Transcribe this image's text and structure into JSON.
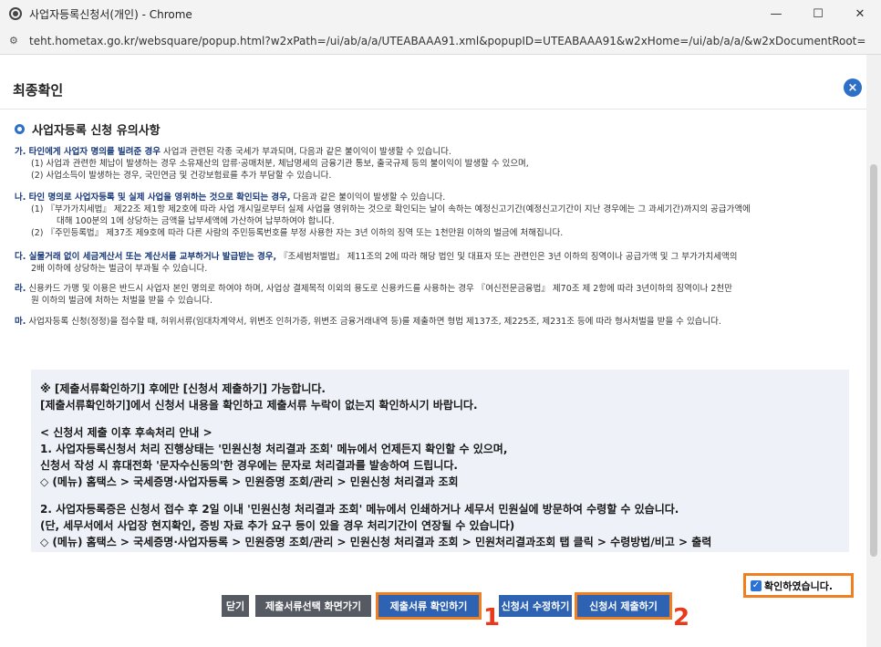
{
  "window": {
    "title": "사업자등록신청서(개인) - Chrome",
    "url": "teht.hometax.go.kr/websquare/popup.html?w2xPath=/ui/ab/a/a/UTEABAAA91.xml&popupID=UTEABAAA91&w2xHome=/ui/ab/a/a/&w2xDocumentRoot=",
    "controls": {
      "minimize": "—",
      "maximize": "☐",
      "close": "✕"
    }
  },
  "dialog": {
    "title": "최종확인",
    "close_label": "×",
    "section_title": "사업자등록 신청 유의사항"
  },
  "notices": [
    {
      "lead": "가. 타인에게 사업자 명의를 빌려준 경우",
      "text": " 사업과 관련된 각종 국세가 부과되며, 다음과 같은 불이익이 발생할 수 있습니다.",
      "subs": [
        "(1) 사업과 관련한 체납이 발생하는 경우 소유재산의 압류·공매처분, 체납명세의 금융기관 통보, 출국규제 등의 불이익이 발생할 수 있으며,",
        "(2) 사업소득이 발생하는 경우, 국민연금 및 건강보험료를 추가 부담할 수 있습니다."
      ]
    },
    {
      "lead": "나. 타인 명의로 사업자등록 및 실제 사업을 영위하는 것으로 확인되는 경우,",
      "text": " 다음과 같은 불이익이 발생할 수 있습니다.",
      "subs": [
        "(1) 『부가가치세법』 제22조 제1항 제2호에 따라 사업 개시일로부터 실제 사업을 영위하는 것으로 확인되는 날이 속하는 예정신고기간(예정신고기간이 지난 경우에는 그 과세기간)까지의 공급가액에",
        "대해 100분의 1에 상당하는 금액을 납부세액에 가산하여 납부하여야 합니다.",
        "(2) 『주민등록법』 제37조 제9호에 따라 다른 사람의 주민등록번호를 부정 사용한 자는 3년 이하의 징역 또는 1천만원 이하의 벌금에 처해집니다."
      ]
    },
    {
      "lead": "다. 실물거래 없이 세금계산서 또는 계산서를 교부하거나 발급받는 경우,",
      "text": " 『조세범처벌법』 제11조의 2에 따라 해당 법인 및 대표자 또는 관련인은 3년 이하의 징역이나 공급가액 및 그 부가가치세액의",
      "subs": [
        "2배 이하에 상당하는 벌금이 부과될 수 있습니다."
      ]
    },
    {
      "lead": "라.",
      "text": " 신용카드 가맹 및 이용은 반드시 사업자 본인 명의로 하여야 하며, 사업상 결제목적 이외의 용도로 신용카드를 사용하는 경우 『여신전문금융법』 제70조 제 2항에 따라 3년이하의 징역이나 2천만",
      "subs": [
        "원 이하의 벌금에 처하는 처벌을 받을 수 있습니다."
      ]
    },
    {
      "lead": "마.",
      "text": " 사업자등록 신청(정정)을 접수할 때, 허위서류(임대차계약서, 위변조 인허가증, 위변조 금융거래내역 등)를 제출하면 형법 제137조, 제225조, 제231조 등에 따라 형사처벌을 받을 수 있습니다.",
      "subs": []
    }
  ],
  "info_box": {
    "lines": [
      "※  [제출서류확인하기] 후에만 [신청서 제출하기] 가능합니다.",
      "     [제출서류확인하기]에서 신청서 내용을 확인하고 제출서류 누락이 없는지 확인하시기 바랍니다.",
      "< 신청서 제출 이후 후속처리 안내 >",
      "1.  사업자등록신청서 처리 진행상태는 '민원신청 처리결과 조회' 메뉴에서 언제든지 확인할 수 있으며,",
      "     신청서 작성 시 휴대전화 '문자수신동의'한 경우에는 문자로 처리결과를 발송하여 드립니다.",
      "     ◇ (메뉴) 홈택스 > 국세증명·사업자등록 > 민원증명 조회/관리 > 민원신청 처리결과 조회",
      "2.  사업자등록증은 신청서 접수 후 2일 이내 '민원신청 처리결과 조회' 메뉴에서 인쇄하거나 세무서 민원실에 방문하여 수령할 수 있습니다.",
      "     (단, 세무서에서 사업장 현지확인, 증빙 자료 추가 요구 등이 있을 경우 처리기간이 연장될 수 있습니다)",
      "     ◇ (메뉴) 홈택스 > 국세증명·사업자등록 > 민원증명 조회/관리 > 민원신청 처리결과 조회 > 민원처리결과조회 탭 클릭 > 수령방법/비고 > 출력"
    ]
  },
  "confirm": {
    "label": "확인하였습니다.",
    "checked": true
  },
  "buttons": {
    "close": "닫기",
    "doc_select": "제출서류선택 화면가기",
    "doc_check": "제출서류 확인하기",
    "edit": "신청서 수정하기",
    "submit": "신청서 제출하기"
  },
  "markers": {
    "first": "1",
    "second": "2"
  },
  "colors": {
    "accent": "#2e62b3",
    "highlight": "#f07f22",
    "marker": "#e8391c"
  }
}
